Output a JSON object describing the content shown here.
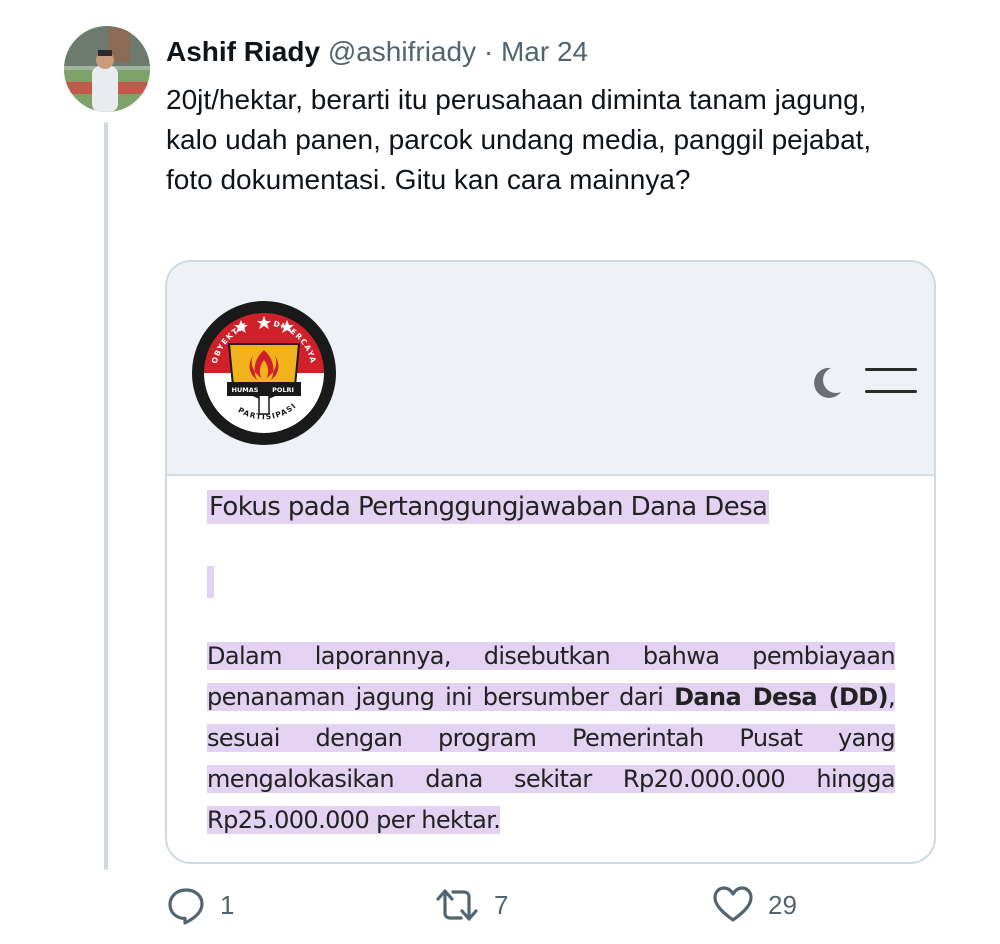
{
  "tweet": {
    "author_name": "Ashif Riady",
    "author_handle": "@ashifriady",
    "separator": "·",
    "date": "Mar 24",
    "text": "20jt/hektar, berarti itu perusahaan diminta tanam jagung, kalo udah panen, parcok undang media, panggil pejabat, foto dokumentasi. Gitu kan cara mainnya?"
  },
  "card": {
    "logo": {
      "icon": "humas-polri-logo",
      "top_left": "OBYEKTIF",
      "top_right": "DIPERCAYA",
      "bottom": "PARTISIPASI",
      "banner_left": "HUMAS",
      "banner_right": "POLRI",
      "colors": {
        "red": "#d0202a",
        "black": "#1a1a1a",
        "gold": "#f2b21c"
      }
    },
    "moon_icon": "moon-icon",
    "menu_icon": "hamburger-menu-icon",
    "title": "Fokus pada Pertanggungjawaban Dana Desa",
    "body": {
      "part1": "Dalam laporannya, disebutkan bahwa pembiayaan penanaman jagung ini bersumber dari ",
      "bold": "Dana Desa (DD)",
      "part2": ", sesuai dengan program Pemerintah Pusat yang mengalokasikan dana sekitar Rp20.000.000 hingga Rp25.000.000 per hektar."
    },
    "highlight_color": "#e3d2f2"
  },
  "actions": {
    "reply": {
      "icon": "reply-icon",
      "count": "1"
    },
    "retweet": {
      "icon": "retweet-icon",
      "count": "7"
    },
    "like": {
      "icon": "heart-icon",
      "count": "29"
    }
  }
}
